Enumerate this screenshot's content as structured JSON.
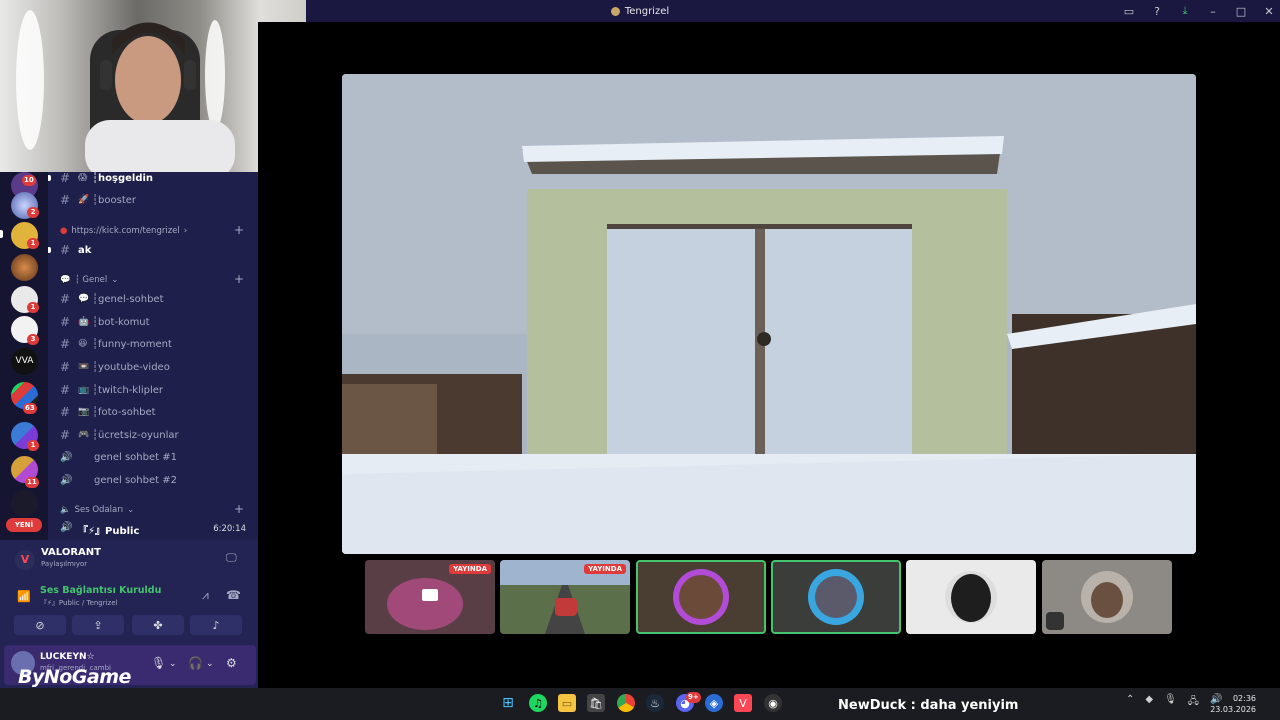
{
  "window": {
    "title": "Tengrizel"
  },
  "rail": {
    "badges": [
      "10",
      "2",
      "1",
      "1",
      "3",
      "63",
      "1",
      "11"
    ],
    "new_label": "YENİ"
  },
  "channels": {
    "top": [
      {
        "emoji": "😱",
        "name": "┆hoşgeldin",
        "highlight": true
      },
      {
        "emoji": "🚀",
        "name": "┆booster",
        "highlight": false
      }
    ],
    "kick_category": "https://kick.com/tengrizel",
    "kick_channel": "ak",
    "genel_category": "┆ Genel",
    "genel": [
      {
        "emoji": "💬",
        "name": "┆genel-sohbet"
      },
      {
        "emoji": "🤖",
        "name": "┆bot-komut"
      },
      {
        "emoji": "😆",
        "name": "┆funny-moment"
      },
      {
        "emoji": "📼",
        "name": "┆youtube-video"
      },
      {
        "emoji": "📺",
        "name": "┆twitch-klipler"
      },
      {
        "emoji": "📷",
        "name": "┆foto-sohbet"
      },
      {
        "emoji": "🎮",
        "name": "┆ücretsiz-oyunlar"
      }
    ],
    "voice": [
      {
        "name": "genel sohbet #1"
      },
      {
        "name": "genel sohbet #2"
      }
    ],
    "ses_category": "Ses Odaları",
    "public": {
      "name": "『⚡』Public",
      "timer": "6:20:14"
    }
  },
  "activity": {
    "title": "VALORANT",
    "sub": "Paylaşılmıyor"
  },
  "connection": {
    "title": "Ses Bağlantısı Kuruldu",
    "sub": "『⚡』Public / Tengrizel"
  },
  "user": {
    "name": "LUCKEYN☆",
    "status": "mfri, gerendi, cambi"
  },
  "watermark": "ByNoGame",
  "participants": {
    "live_label": "YAYINDA"
  },
  "taskbar": {
    "chat_user": "NewDuck",
    "chat_text": ": daha yeniyim",
    "time": "02:36",
    "date": "23.03.2026",
    "discord_badge": "9+"
  },
  "colors": {
    "accent": "#5865f2",
    "live": "#e03b3b",
    "connected": "#43c46d",
    "sidebar": "#1e1f4a"
  }
}
